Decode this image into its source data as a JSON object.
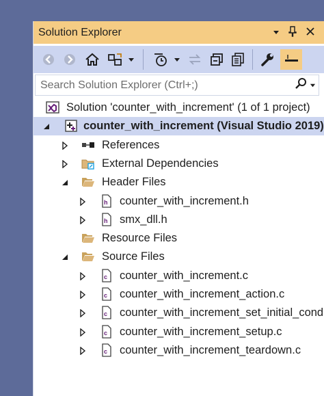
{
  "panel": {
    "title": "Solution Explorer",
    "search_placeholder": "Search Solution Explorer (Ctrl+;)"
  },
  "tree": {
    "solution": "Solution 'counter_with_increment' (1 of 1 project)",
    "project": "counter_with_increment (Visual Studio 2019)",
    "references": "References",
    "external_dependencies": "External Dependencies",
    "header_files": "Header Files",
    "header_items": [
      "counter_with_increment.h",
      "smx_dll.h"
    ],
    "resource_files": "Resource Files",
    "source_files": "Source Files",
    "source_items": [
      "counter_with_increment.c",
      "counter_with_increment_action.c",
      "counter_with_increment_set_initial_conditions.c",
      "counter_with_increment_setup.c",
      "counter_with_increment_teardown.c"
    ]
  },
  "colors": {
    "background": "#5d6b99",
    "title_bar": "#f5cc84",
    "toolbar": "#ccd5f0",
    "selection": "#ccd5f0"
  }
}
